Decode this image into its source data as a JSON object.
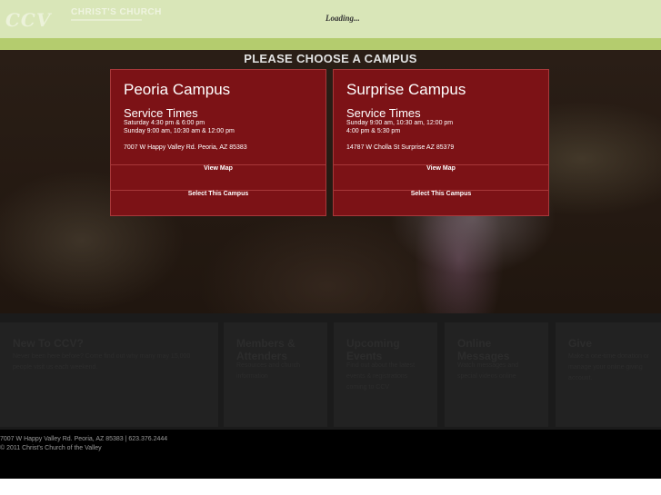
{
  "header": {
    "logo_mark": "CCV",
    "logo_text": "CHRIST'S CHURCH",
    "loading": "Loading..."
  },
  "hero": {
    "title": "PLEASE CHOOSE A CAMPUS"
  },
  "campuses": [
    {
      "name": "Peoria Campus",
      "service_title": "Service Times",
      "lines": [
        "Saturday 4:30 pm & 6:00 pm",
        "Sunday 9:00 am, 10:30 am & 12:00 pm"
      ],
      "address": "7007 W Happy Valley Rd. Peoria, AZ 85383",
      "map_label": "View Map",
      "select_label": "Select This Campus"
    },
    {
      "name": "Surprise Campus",
      "service_title": "Service Times",
      "lines": [
        "Sunday 9:00 am, 10:30 am, 12:00 pm",
        "4:00 pm & 5:30 pm"
      ],
      "address": "14787 W Cholla St Surprise AZ 85379",
      "map_label": "View Map",
      "select_label": "Select This Campus"
    }
  ],
  "tiles": [
    {
      "title": "New To CCV?",
      "text": "Never been here before? Come find out why many may 15,000 people visit us each weekend."
    },
    {
      "title": "Members & Attenders",
      "text": "Resources and church information"
    },
    {
      "title": "Upcoming Events",
      "text": "Find out about the latest events & registrations coming to CCV"
    },
    {
      "title": "Online Messages",
      "text": "Watch messages and special videos online"
    },
    {
      "title": "Give",
      "text": "Make a one-time donation or manage your online giving account."
    }
  ],
  "footer": {
    "address": "7007 W Happy Valley Rd. Peoria, AZ 85383 | 623.376.2444",
    "copyright": "© 2011 Christ's Church of the Valley"
  }
}
